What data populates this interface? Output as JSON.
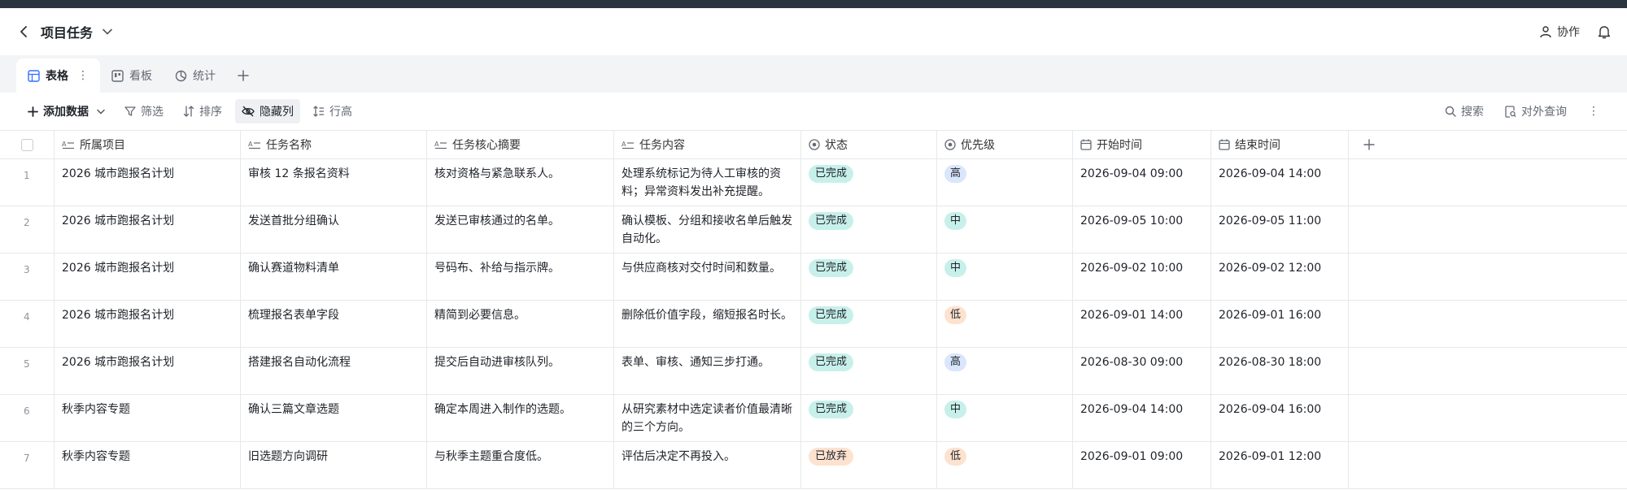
{
  "header": {
    "title": "项目任务",
    "collab_label": "协作"
  },
  "views": [
    {
      "label": "表格",
      "icon": "table-icon",
      "active": true
    },
    {
      "label": "看板",
      "icon": "kanban-icon",
      "active": false
    },
    {
      "label": "统计",
      "icon": "chart-icon",
      "active": false
    }
  ],
  "toolbar": {
    "add_label": "添加数据",
    "filter_label": "筛选",
    "sort_label": "排序",
    "hide_label": "隐藏列",
    "rowheight_label": "行高",
    "search_label": "搜索",
    "query_label": "对外查询"
  },
  "columns": {
    "project": "所属项目",
    "name": "任务名称",
    "summary": "任务核心摘要",
    "content": "任务内容",
    "status": "状态",
    "priority": "优先级",
    "start": "开始时间",
    "end": "结束时间"
  },
  "rows": [
    {
      "idx": "1",
      "project": "2026 城市跑报名计划",
      "name": "审核 12 条报名资料",
      "summary": "核对资格与紧急联系人。",
      "content": "处理系统标记为待人工审核的资料；异常资料发出补充提醒。",
      "status": "已完成",
      "status_type": "done",
      "priority": "高",
      "priority_type": "high",
      "start": "2026-09-04 09:00",
      "end": "2026-09-04 14:00"
    },
    {
      "idx": "2",
      "project": "2026 城市跑报名计划",
      "name": "发送首批分组确认",
      "summary": "发送已审核通过的名单。",
      "content": "确认模板、分组和接收名单后触发自动化。",
      "status": "已完成",
      "status_type": "done",
      "priority": "中",
      "priority_type": "mid",
      "start": "2026-09-05 10:00",
      "end": "2026-09-05 11:00"
    },
    {
      "idx": "3",
      "project": "2026 城市跑报名计划",
      "name": "确认赛道物料清单",
      "summary": "号码布、补给与指示牌。",
      "content": "与供应商核对交付时间和数量。",
      "status": "已完成",
      "status_type": "done",
      "priority": "中",
      "priority_type": "mid",
      "start": "2026-09-02 10:00",
      "end": "2026-09-02 12:00"
    },
    {
      "idx": "4",
      "project": "2026 城市跑报名计划",
      "name": "梳理报名表单字段",
      "summary": "精简到必要信息。",
      "content": "删除低价值字段，缩短报名时长。",
      "status": "已完成",
      "status_type": "done",
      "priority": "低",
      "priority_type": "low",
      "start": "2026-09-01 14:00",
      "end": "2026-09-01 16:00"
    },
    {
      "idx": "5",
      "project": "2026 城市跑报名计划",
      "name": "搭建报名自动化流程",
      "summary": "提交后自动进审核队列。",
      "content": "表单、审核、通知三步打通。",
      "status": "已完成",
      "status_type": "done",
      "priority": "高",
      "priority_type": "high",
      "start": "2026-08-30 09:00",
      "end": "2026-08-30 18:00"
    },
    {
      "idx": "6",
      "project": "秋季内容专题",
      "name": "确认三篇文章选题",
      "summary": "确定本周进入制作的选题。",
      "content": "从研究素材中选定读者价值最清晰的三个方向。",
      "status": "已完成",
      "status_type": "done",
      "priority": "中",
      "priority_type": "mid",
      "start": "2026-09-04 14:00",
      "end": "2026-09-04 16:00"
    },
    {
      "idx": "7",
      "project": "秋季内容专题",
      "name": "旧选题方向调研",
      "summary": "与秋季主题重合度低。",
      "content": "评估后决定不再投入。",
      "status": "已放弃",
      "status_type": "drop",
      "priority": "低",
      "priority_type": "low",
      "start": "2026-09-01 09:00",
      "end": "2026-09-01 12:00"
    }
  ]
}
